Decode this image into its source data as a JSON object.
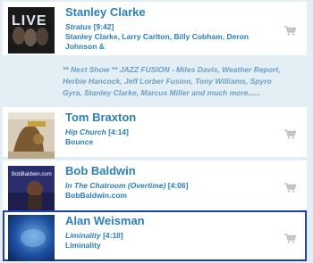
{
  "tracks": [
    {
      "artist": "Stanley Clarke",
      "title": "Stratus",
      "duration": "[9:42]",
      "album": "Stanley Clarke, Larry Carlton, Billy Cobham, Deron Johnson &",
      "cover_text": "LIVE",
      "cover_color": "#1a1a1a"
    },
    {
      "artist": "Tom Braxton",
      "title": "Hip Church",
      "duration": "[4:14]",
      "album": "Bounce",
      "cover_color": "#d8cdb8"
    },
    {
      "artist": "Bob Baldwin",
      "title": "In The Chatroom (Overtime)",
      "duration": "[4:06]",
      "album": "BobBaldwin.com",
      "cover_text": "BobBaldwin.com",
      "cover_color": "#2a2e6e"
    },
    {
      "artist": "Alan Weisman",
      "title": "Liminality",
      "duration": "[4:18]",
      "album": "Liminality",
      "cover_color": "#1d4fa0"
    }
  ],
  "next_show_note": "** Next Show ** JAZZ FUSION - Miles Davis, Weather Report, Herbie Hancock, Jeff Lorber Fusion, Tony Williams, Spyro Gyra, Stanley Clarke, Marcus Miller and much more......",
  "colors": {
    "accent": "#2a7fb8",
    "note": "#6aa0c8",
    "background": "#e4eef5",
    "selection_border": "#1e3fb8",
    "cart_icon": "#b8bcc0"
  }
}
